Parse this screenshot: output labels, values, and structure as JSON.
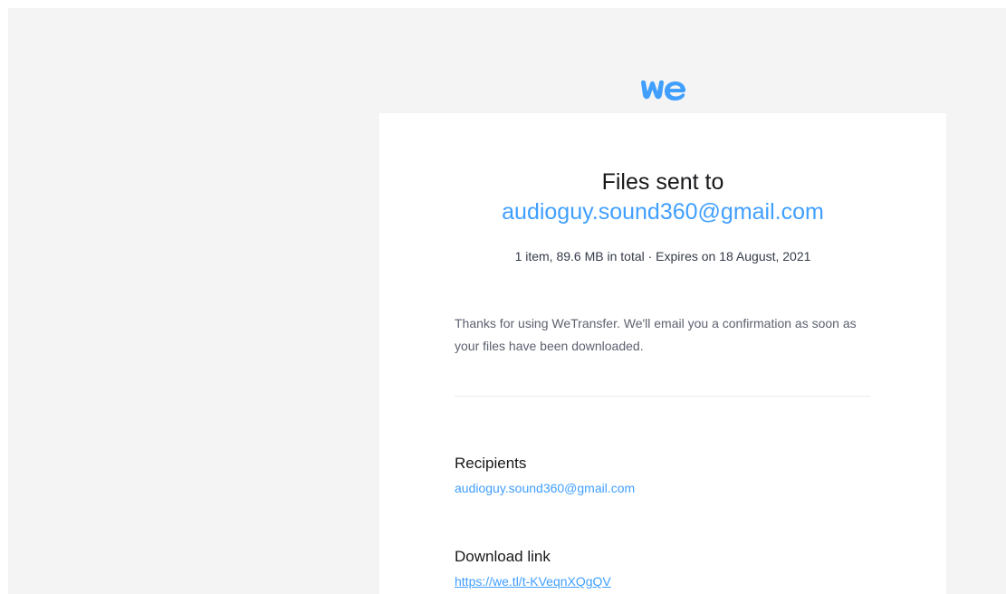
{
  "brand": {
    "logo_icon": "wetransfer-we-logo",
    "accent_color": "#409fff",
    "background_color": "#f4f4f4"
  },
  "header": {
    "title": "Files sent to",
    "recipient_email": "audioguy.sound360@gmail.com",
    "summary": "1 item, 89.6 MB in total · Expires on 18 August, 2021"
  },
  "message": {
    "text": "Thanks for using WeTransfer. We'll email you a confirmation as soon as your files have been downloaded."
  },
  "recipients": {
    "heading": "Recipients",
    "email": "audioguy.sound360@gmail.com"
  },
  "download": {
    "heading": "Download link",
    "url": "https://we.tl/t-KVeqnXQgQV"
  }
}
